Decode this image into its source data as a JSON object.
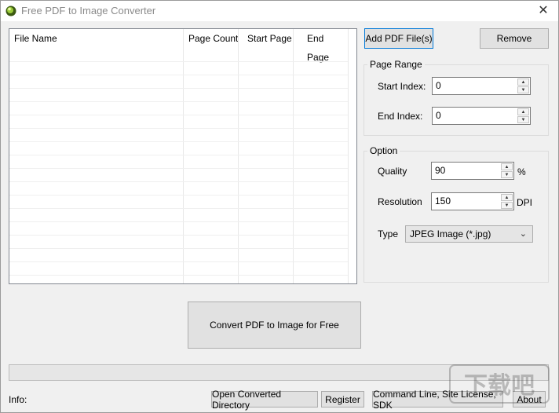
{
  "window": {
    "title": "Free PDF to Image Converter"
  },
  "file_list": {
    "columns": [
      "File Name",
      "Page Count",
      "Start Page",
      "End Page"
    ],
    "rows": []
  },
  "buttons": {
    "add": "Add PDF File(s)",
    "remove": "Remove",
    "convert": "Convert PDF to Image for Free",
    "open_dir": "Open Converted Directory",
    "register": "Register",
    "command_line": "Command Line, Site License, SDK",
    "about": "About"
  },
  "page_range": {
    "title": "Page Range",
    "start_label": "Start Index:",
    "start_value": "0",
    "end_label": "End Index:",
    "end_value": "0"
  },
  "option": {
    "title": "Option",
    "quality_label": "Quality",
    "quality_value": "90",
    "quality_unit": "%",
    "resolution_label": "Resolution",
    "resolution_value": "150",
    "resolution_unit": "DPI",
    "type_label": "Type",
    "type_value": "JPEG Image (*.jpg)"
  },
  "status": {
    "info_label": "Info:",
    "progress": 0
  },
  "watermark": {
    "text": "下载吧"
  },
  "colors": {
    "focus_border": "#0078d7",
    "button_face": "#e1e1e1",
    "window_bg": "#f0f0f0"
  }
}
